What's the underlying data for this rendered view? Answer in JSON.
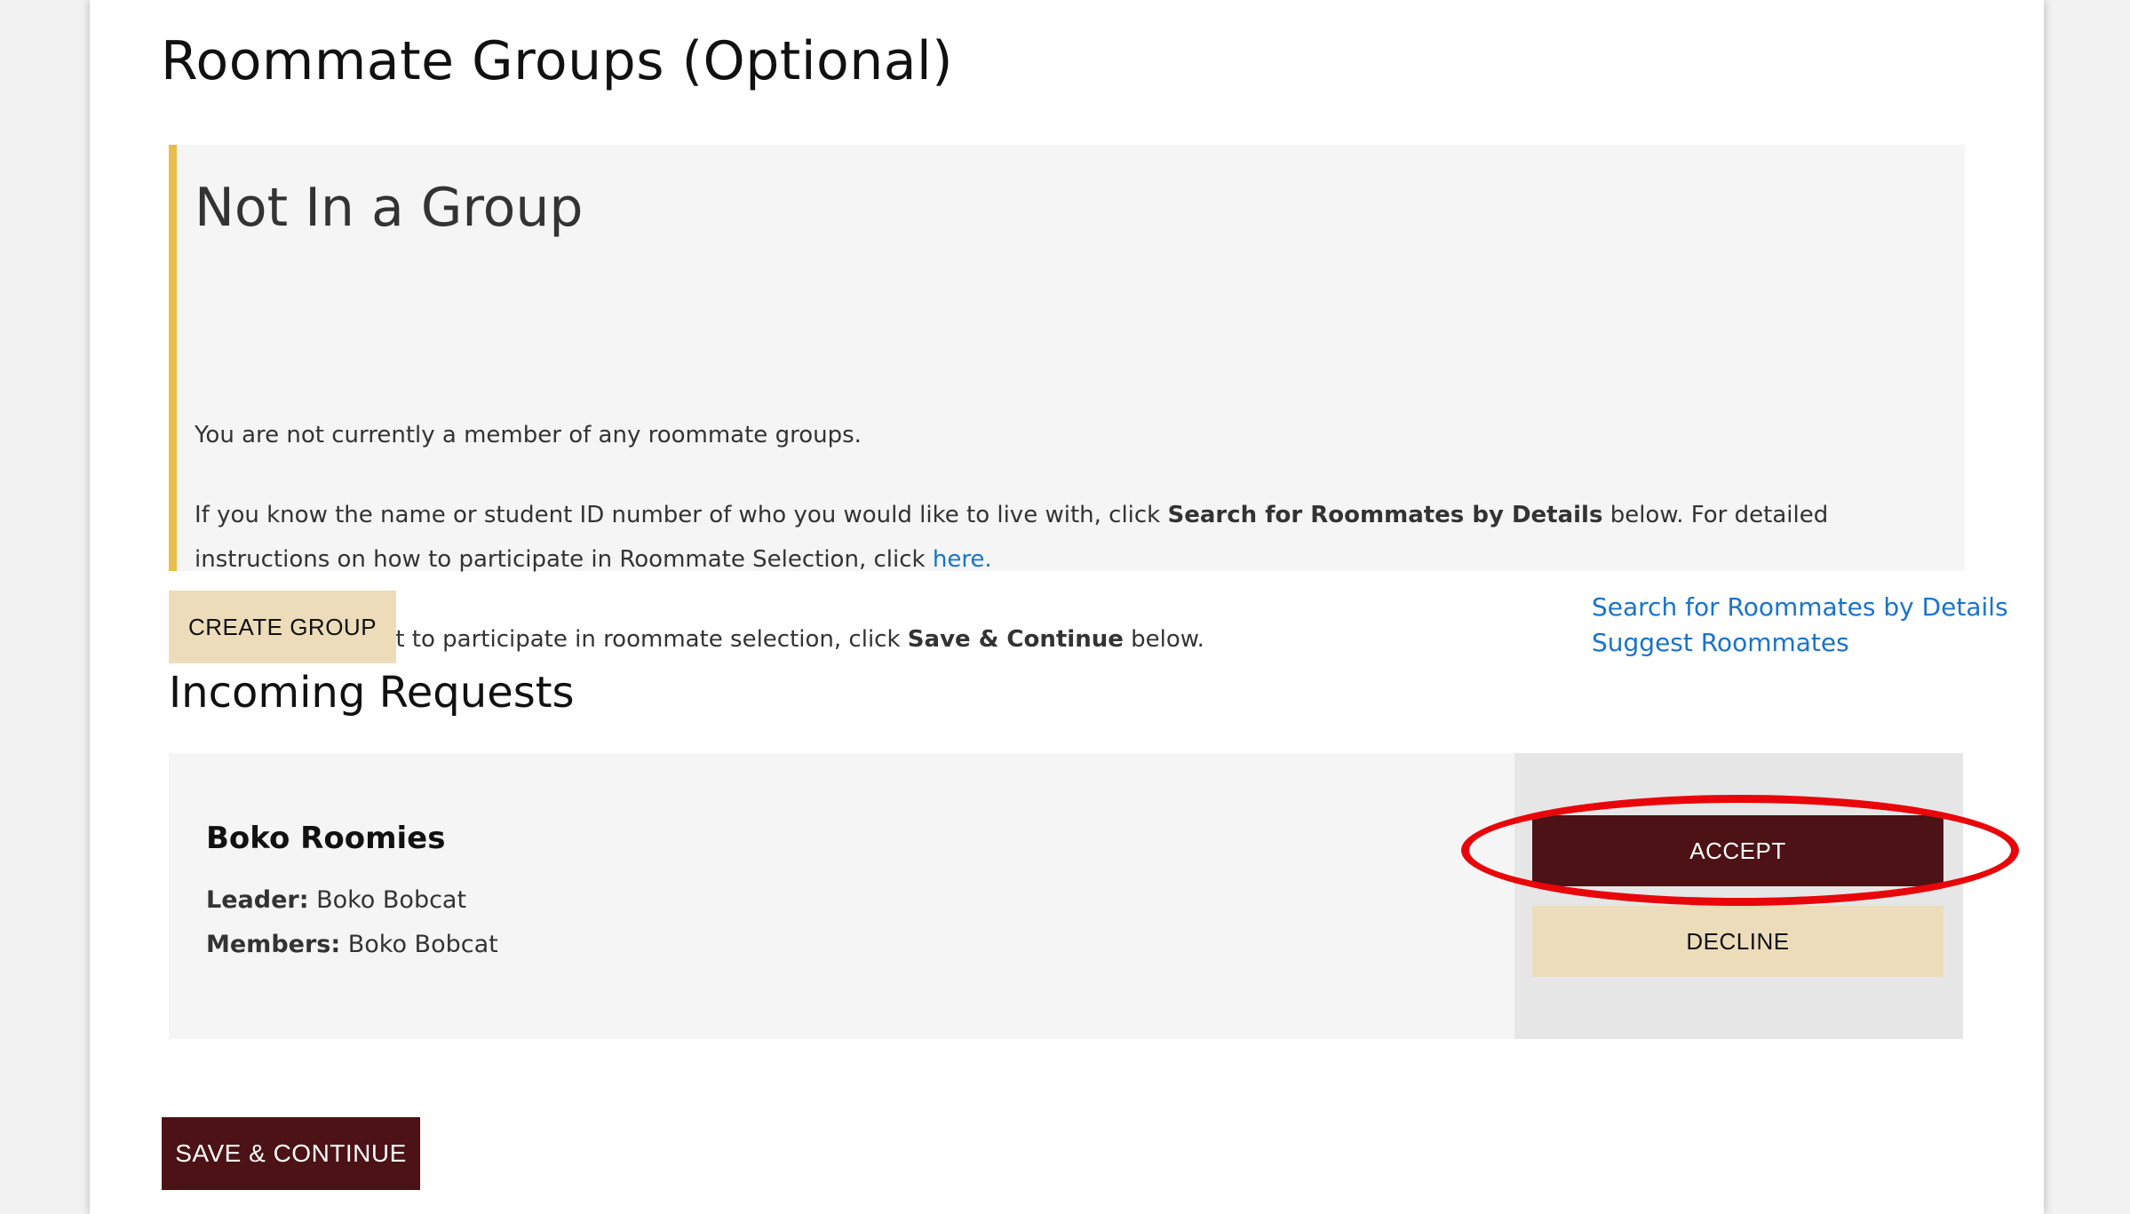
{
  "page": {
    "title": "Roommate Groups (Optional)"
  },
  "notice": {
    "heading": "Not In a Group",
    "paragraph1": "You are not currently a member of any roommate groups.",
    "paragraph2_before": "If you know the name or student ID number of who you would like to live with, click ",
    "paragraph2_bold": "Search for Roommates by Details",
    "paragraph2_middle": " below. For detailed instructions on how to participate in Roommate Selection, click ",
    "paragraph2_link": "here.",
    "paragraph3_before": "If you do not want to participate in roommate selection, click ",
    "paragraph3_bold": "Save & Continue",
    "paragraph3_after": " below.",
    "accent_color": "#e8bd4a"
  },
  "actions": {
    "create_group_label": "CREATE GROUP",
    "search_link": "Search for Roommates by Details",
    "suggest_link": "Suggest Roommates"
  },
  "incoming": {
    "heading": "Incoming Requests",
    "requests": [
      {
        "group_name": "Boko Roomies",
        "leader_label": "Leader:",
        "leader_value": " Boko Bobcat",
        "members_label": "Members:",
        "members_value": " Boko Bobcat",
        "accept_label": "ACCEPT",
        "decline_label": "DECLINE"
      }
    ]
  },
  "footer": {
    "save_label": "SAVE & CONTINUE"
  },
  "colors": {
    "maroon": "#4d1215",
    "cream": "#ecdcba",
    "link": "#1a73c9",
    "annotation": "#e8060b"
  }
}
